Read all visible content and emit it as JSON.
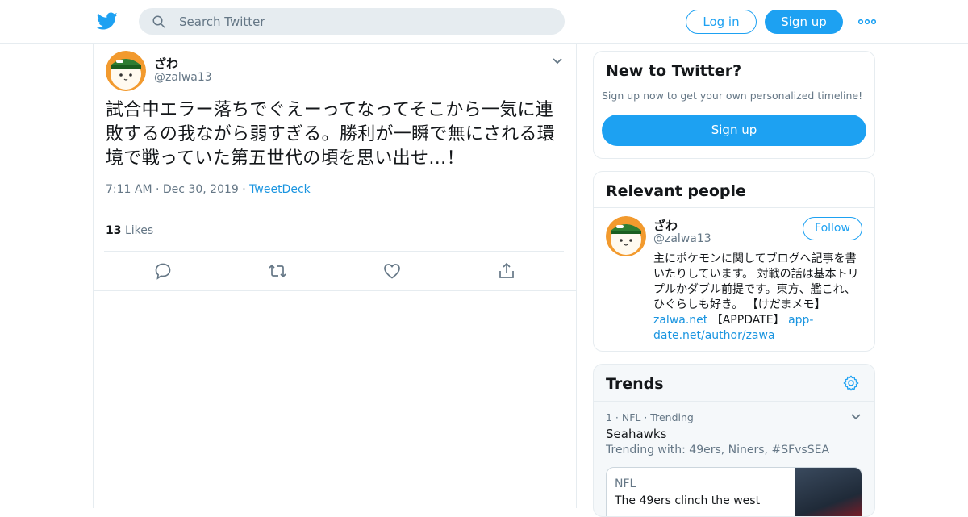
{
  "header": {
    "search_placeholder": "Search Twitter",
    "login_label": "Log in",
    "signup_label": "Sign up",
    "brand_color": "#1da1f2"
  },
  "tweet": {
    "author_name": "ざわ",
    "author_handle": "@zalwa13",
    "text": "試合中エラー落ちでぐえーってなってそこから一気に連敗するの我ながら弱すぎる。勝利が一瞬で無にされる環境で戦っていた第五世代の頃を思い出せ…！",
    "time": "7:11 AM",
    "date": "Dec 30, 2019",
    "source": "TweetDeck",
    "likes_count": "13",
    "likes_label": "Likes"
  },
  "sidebar": {
    "new_to_twitter": {
      "title": "New to Twitter?",
      "subtitle": "Sign up now to get your own personalized timeline!",
      "signup_label": "Sign up"
    },
    "relevant_people": {
      "title": "Relevant people",
      "name": "ざわ",
      "handle": "@zalwa13",
      "follow_label": "Follow",
      "bio_text": "主にポケモンに関してブログへ記事を書いたりしています。 対戦の話は基本トリプルかダブル前提です。東方、艦これ、ひぐらしも好き。 【けだまメモ】",
      "bio_link1": "zalwa.net",
      "bio_mid": " 【APPDATE】 ",
      "bio_link2": "app-date.net/author/zawa"
    },
    "trends": {
      "title": "Trends",
      "items": [
        {
          "meta": "1 · NFL · Trending",
          "name": "Seahawks",
          "trending_with": "Trending with: 49ers, Niners, #SFvsSEA",
          "news_source": "NFL",
          "news_headline": "The 49ers clinch the west"
        }
      ]
    }
  }
}
